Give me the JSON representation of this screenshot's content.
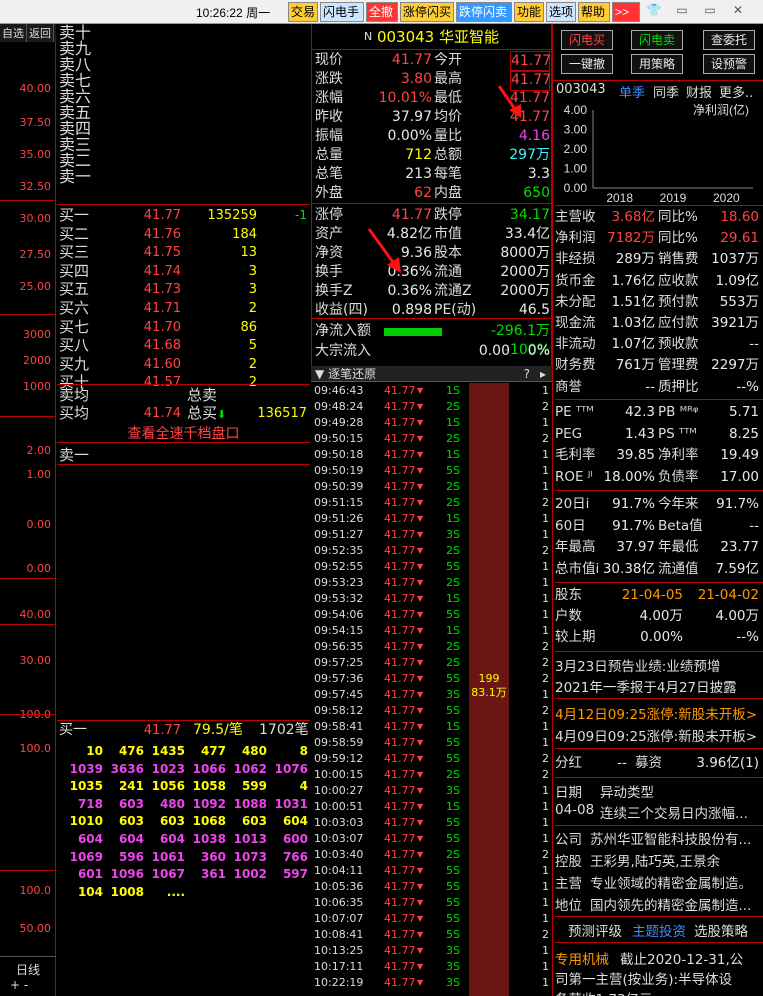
{
  "topbar": {
    "clock": "10:26:22",
    "weekday": "周一",
    "buttons": [
      {
        "label": "交易",
        "bg": "#ffcc33",
        "fg": "#000"
      },
      {
        "label": "闪电手",
        "bg": "#cce6ff",
        "fg": "#000"
      },
      {
        "label": "全撤",
        "bg": "#ff3333",
        "fg": "#fff"
      },
      {
        "label": "涨停闪买",
        "bg": "#ffcc33",
        "fg": "#000"
      },
      {
        "label": "跌停闪卖",
        "bg": "#3399ff",
        "fg": "#fff"
      },
      {
        "label": "功能",
        "bg": "#ffcc33",
        "fg": "#000"
      },
      {
        "label": "选项",
        "bg": "#cce6ff",
        "fg": "#000"
      },
      {
        "label": "帮助",
        "bg": "#ffcc33",
        "fg": "#000"
      },
      {
        "label": ">>",
        "bg": "#ff3333",
        "fg": "#fff"
      }
    ]
  },
  "left_tabs": [
    "自选",
    "返回"
  ],
  "left_axis_labels": [
    "40.00",
    "37.50",
    "35.00",
    "32.50",
    "30.00",
    "27.50",
    "25.00",
    "3000",
    "2000",
    "1000",
    "2.00",
    "1.00",
    "0.00",
    "0.00",
    "40.00",
    "30.00",
    "100.0",
    "100.0",
    "100.0",
    "50.00"
  ],
  "left_bottom": {
    "label": "日线",
    "plus": "+",
    "minus": "-"
  },
  "book": {
    "sell": [
      {
        "name": "卖十",
        "price": "",
        "vol": ""
      },
      {
        "name": "卖九",
        "price": "",
        "vol": ""
      },
      {
        "name": "卖八",
        "price": "",
        "vol": ""
      },
      {
        "name": "卖七",
        "price": "",
        "vol": ""
      },
      {
        "name": "卖六",
        "price": "",
        "vol": ""
      },
      {
        "name": "卖五",
        "price": "",
        "vol": ""
      },
      {
        "name": "卖四",
        "price": "",
        "vol": ""
      },
      {
        "name": "卖三",
        "price": "",
        "vol": ""
      },
      {
        "name": "卖二",
        "price": "",
        "vol": ""
      },
      {
        "name": "卖一",
        "price": "",
        "vol": ""
      }
    ],
    "buy": [
      {
        "name": "买一",
        "price": "41.77",
        "vol": "135259",
        "chg": "-1"
      },
      {
        "name": "买二",
        "price": "41.76",
        "vol": "184",
        "chg": ""
      },
      {
        "name": "买三",
        "price": "41.75",
        "vol": "13",
        "chg": ""
      },
      {
        "name": "买四",
        "price": "41.74",
        "vol": "3",
        "chg": ""
      },
      {
        "name": "买五",
        "price": "41.73",
        "vol": "3",
        "chg": ""
      },
      {
        "name": "买六",
        "price": "41.71",
        "vol": "2",
        "chg": ""
      },
      {
        "name": "买七",
        "price": "41.70",
        "vol": "86",
        "chg": ""
      },
      {
        "name": "买八",
        "price": "41.68",
        "vol": "5",
        "chg": ""
      },
      {
        "name": "买九",
        "price": "41.60",
        "vol": "2",
        "chg": ""
      },
      {
        "name": "买十",
        "price": "41.57",
        "vol": "2",
        "chg": ""
      }
    ],
    "sell_avg_label": "卖均",
    "total_sell_label": "总卖",
    "buy_avg_label": "买均",
    "buy_avg": "41.74",
    "total_buy_label": "总买",
    "total_buy": "136517",
    "full_book": "查看全速千档盘口",
    "sell1_label": "卖一",
    "queue_head": {
      "name": "买一",
      "price": "41.77",
      "per": "79.5/笔",
      "count": "1702笔"
    },
    "queue_rows": [
      [
        "10",
        "476",
        "1435",
        "477",
        "480",
        "8"
      ],
      [
        "1039",
        "3636",
        "1023",
        "1066",
        "1062",
        "1076"
      ],
      [
        "1035",
        "241",
        "1056",
        "1058",
        "599",
        "4"
      ],
      [
        "718",
        "603",
        "480",
        "1092",
        "1088",
        "1031"
      ],
      [
        "1010",
        "603",
        "603",
        "1068",
        "603",
        "604"
      ],
      [
        "604",
        "604",
        "604",
        "1038",
        "1013",
        "600"
      ],
      [
        "1069",
        "596",
        "1061",
        "360",
        "1073",
        "766"
      ],
      [
        "601",
        "1096",
        "1067",
        "361",
        "1002",
        "597"
      ],
      [
        "104",
        "1008",
        "....",
        "",
        "",
        ""
      ]
    ]
  },
  "quote": {
    "flag": "N",
    "code": "003043",
    "name": "华亚智能",
    "rows": [
      {
        "k1": "现价",
        "v1": "41.77",
        "c1": "red",
        "k2": "今开",
        "v2": "41.77",
        "c2": "red",
        "box2": true
      },
      {
        "k1": "涨跌",
        "v1": "3.80",
        "c1": "red",
        "k2": "最高",
        "v2": "41.77",
        "c2": "red",
        "box2": true
      },
      {
        "k1": "涨幅",
        "v1": "10.01%",
        "c1": "red",
        "k2": "最低",
        "v2": "41.77",
        "c2": "red"
      },
      {
        "k1": "昨收",
        "v1": "37.97",
        "c1": "wht",
        "k2": "均价",
        "v2": "41.77",
        "c2": "red"
      },
      {
        "k1": "振幅",
        "v1": "0.00%",
        "c1": "wht",
        "k2": "量比",
        "v2": "4.16",
        "c2": "mag"
      },
      {
        "k1": "总量",
        "v1": "712",
        "c1": "yel",
        "k2": "总额",
        "v2": "297万",
        "c2": "cyn"
      },
      {
        "k1": "总笔",
        "v1": "213",
        "c1": "wht",
        "k2": "每笔",
        "v2": "3.3",
        "c2": "wht"
      },
      {
        "k1": "外盘",
        "v1": "62",
        "c1": "red",
        "k2": "内盘",
        "v2": "650",
        "c2": "grn"
      },
      {
        "k1": "涨停",
        "v1": "41.77",
        "c1": "red",
        "k2": "跌停",
        "v2": "34.17",
        "c2": "grn"
      },
      {
        "k1": "资产",
        "v1": "4.82亿",
        "c1": "wht",
        "k2": "市值",
        "v2": "33.4亿",
        "c2": "wht"
      },
      {
        "k1": "净资",
        "v1": "9.36",
        "c1": "wht",
        "k2": "股本",
        "v2": "8000万",
        "c2": "wht"
      },
      {
        "k1": "换手",
        "v1": "0.36%",
        "c1": "wht",
        "k2": "流通",
        "v2": "2000万",
        "c2": "wht"
      },
      {
        "k1": "换手Z",
        "v1": "0.36%",
        "c1": "wht",
        "k2": "流通Z",
        "v2": "2000万",
        "c2": "wht"
      },
      {
        "k1": "收益(四)",
        "v1": "0.898",
        "c1": "wht",
        "k2": "PE(动)",
        "v2": "46.5",
        "c2": "wht"
      }
    ],
    "net_inflow_label": "净流入额",
    "net_inflow": "-296.1万",
    "net_inflow_pct": "-100%",
    "block_label": "大宗流入",
    "block_value": "0.00",
    "block_pct": "0%"
  },
  "ticks": {
    "header": "逐笔还原",
    "rows": [
      {
        "t": "09:46:43",
        "p": "41.77",
        "v": "1S",
        "n": "1"
      },
      {
        "t": "09:48:24",
        "p": "41.77",
        "v": "2S",
        "n": "2"
      },
      {
        "t": "09:49:28",
        "p": "41.77",
        "v": "1S",
        "n": "1"
      },
      {
        "t": "09:50:15",
        "p": "41.77",
        "v": "2S",
        "n": "2"
      },
      {
        "t": "09:50:18",
        "p": "41.77",
        "v": "1S",
        "n": "1"
      },
      {
        "t": "09:50:19",
        "p": "41.77",
        "v": "5S",
        "n": "1"
      },
      {
        "t": "09:50:39",
        "p": "41.77",
        "v": "2S",
        "n": "1"
      },
      {
        "t": "09:51:15",
        "p": "41.77",
        "v": "2S",
        "n": "2"
      },
      {
        "t": "09:51:26",
        "p": "41.77",
        "v": "1S",
        "n": "1"
      },
      {
        "t": "09:51:27",
        "p": "41.77",
        "v": "3S",
        "n": "1"
      },
      {
        "t": "09:52:35",
        "p": "41.77",
        "v": "2S",
        "n": "2"
      },
      {
        "t": "09:52:55",
        "p": "41.77",
        "v": "5S",
        "n": "1"
      },
      {
        "t": "09:53:23",
        "p": "41.77",
        "v": "2S",
        "n": "1"
      },
      {
        "t": "09:53:32",
        "p": "41.77",
        "v": "1S",
        "n": "1"
      },
      {
        "t": "09:54:06",
        "p": "41.77",
        "v": "5S",
        "n": "1"
      },
      {
        "t": "09:54:15",
        "p": "41.77",
        "v": "1S",
        "n": "1"
      },
      {
        "t": "09:56:35",
        "p": "41.77",
        "v": "2S",
        "n": "2"
      },
      {
        "t": "09:57:25",
        "p": "41.77",
        "v": "2S",
        "n": "2"
      },
      {
        "t": "09:57:36",
        "p": "41.77",
        "v": "5S",
        "n": "2"
      },
      {
        "t": "09:57:45",
        "p": "41.77",
        "v": "3S",
        "n": "1"
      },
      {
        "t": "09:58:12",
        "p": "41.77",
        "v": "5S",
        "n": "2"
      },
      {
        "t": "09:58:41",
        "p": "41.77",
        "v": "1S",
        "n": "1"
      },
      {
        "t": "09:58:59",
        "p": "41.77",
        "v": "5S",
        "n": "1"
      },
      {
        "t": "09:59:12",
        "p": "41.77",
        "v": "5S",
        "n": "2"
      },
      {
        "t": "10:00:15",
        "p": "41.77",
        "v": "2S",
        "n": "2"
      },
      {
        "t": "10:00:27",
        "p": "41.77",
        "v": "3S",
        "n": "1"
      },
      {
        "t": "10:00:51",
        "p": "41.77",
        "v": "1S",
        "n": "1"
      },
      {
        "t": "10:03:03",
        "p": "41.77",
        "v": "5S",
        "n": "1"
      },
      {
        "t": "10:03:07",
        "p": "41.77",
        "v": "5S",
        "n": "1"
      },
      {
        "t": "10:03:40",
        "p": "41.77",
        "v": "2S",
        "n": "2"
      },
      {
        "t": "10:04:11",
        "p": "41.77",
        "v": "5S",
        "n": "1"
      },
      {
        "t": "10:05:36",
        "p": "41.77",
        "v": "5S",
        "n": "1"
      },
      {
        "t": "10:06:35",
        "p": "41.77",
        "v": "5S",
        "n": "1"
      },
      {
        "t": "10:07:07",
        "p": "41.77",
        "v": "5S",
        "n": "1"
      },
      {
        "t": "10:08:41",
        "p": "41.77",
        "v": "5S",
        "n": "2"
      },
      {
        "t": "10:13:25",
        "p": "41.77",
        "v": "3S",
        "n": "1"
      },
      {
        "t": "10:17:11",
        "p": "41.77",
        "v": "3S",
        "n": "1"
      },
      {
        "t": "10:22:19",
        "p": "41.77",
        "v": "3S",
        "n": "1"
      }
    ],
    "bar_label1": "199",
    "bar_label2": "83.1万"
  },
  "right": {
    "buttons": [
      "闪电买",
      "闪电卖",
      "查委托",
      "一键撤",
      "用策略",
      "设预警"
    ],
    "code": "003043",
    "season": "单季",
    "yoy": "同季",
    "fin": "财报",
    "more": "更多..",
    "chart_title": "净利润(亿)",
    "chart_data": {
      "type": "bar",
      "categories": [
        "2018",
        "2019",
        "2020"
      ],
      "values": [
        0,
        0,
        0
      ],
      "ylim": [
        0,
        4
      ],
      "yticks": [
        "4.00",
        "3.00",
        "2.00",
        "1.00",
        "0.00"
      ]
    },
    "fin_rows": [
      {
        "a": "主营收",
        "b": "3.68亿",
        "c": "同比%",
        "d": "18.60",
        "bc": "red",
        "dc": "red"
      },
      {
        "a": "净利润",
        "b": "7182万",
        "c": "同比%",
        "d": "29.61",
        "bc": "red",
        "dc": "red"
      },
      {
        "a": "非经损",
        "b": "289万",
        "c": "销售费",
        "d": "1037万",
        "bc": "wht",
        "dc": "wht"
      },
      {
        "a": "货币金",
        "b": "1.76亿",
        "c": "应收款",
        "d": "1.09亿",
        "bc": "wht",
        "dc": "wht"
      },
      {
        "a": "未分配",
        "b": "1.51亿",
        "c": "预付款",
        "d": "553万",
        "bc": "wht",
        "dc": "wht"
      },
      {
        "a": "现金流",
        "b": "1.03亿",
        "c": "应付款",
        "d": "3921万",
        "bc": "wht",
        "dc": "wht"
      },
      {
        "a": "非流动",
        "b": "1.07亿",
        "c": "预收款",
        "d": "--",
        "bc": "wht",
        "dc": "wht"
      },
      {
        "a": "财务费",
        "b": "761万",
        "c": "管理费",
        "d": "2297万",
        "bc": "wht",
        "dc": "wht"
      },
      {
        "a": "商誉",
        "b": "--",
        "c": "质押比",
        "d": "--%",
        "bc": "wht",
        "dc": "wht"
      }
    ],
    "val_rows": [
      {
        "a": "PE ᵀᵀᴹ",
        "b": "42.3",
        "c": "PB ᴹᴿᵠ",
        "d": "5.71"
      },
      {
        "a": "PEG",
        "b": "1.43",
        "c": "PS ᵀᵀᴹ",
        "d": "8.25"
      },
      {
        "a": "毛利率",
        "b": "39.85",
        "c": "净利率",
        "d": "19.49"
      },
      {
        "a": "ROE ᴶᴵ",
        "b": "18.00%",
        "c": "负债率",
        "d": "17.00"
      }
    ],
    "perf_rows": [
      {
        "a": "20日i",
        "b": "91.7%",
        "c": "今年来",
        "d": "91.7%"
      },
      {
        "a": "60日",
        "b": "91.7%",
        "c": "Beta值",
        "d": "--"
      },
      {
        "a": "年最高",
        "b": "37.97",
        "c": "年最低",
        "d": "23.77"
      },
      {
        "a": "总市值i",
        "b": "30.38亿",
        "c": "流通值",
        "d": "7.59亿"
      }
    ],
    "holders": {
      "label": "股东",
      "d1": "21-04-05",
      "d2": "21-04-02",
      "hu": "户数",
      "h1": "4.00万",
      "h2": "4.00万",
      "cmp": "较上期",
      "c1": "0.00%",
      "c2": "--%"
    },
    "news": [
      "3月23日预告业绩:业绩预增",
      "2021年一季报于4月27日披露"
    ],
    "limit_news": [
      "4月12日09:25涨停:新股未开板>",
      "4月09日09:25涨停:新股未开板>"
    ],
    "dividend": {
      "a": "分红",
      "b": "--",
      "c": "募资",
      "d": "3.96亿(1)"
    },
    "abnormal": {
      "date_label": "日期",
      "type_label": "异动类型",
      "date": "04-08",
      "type": "连续三个交易日内涨幅..."
    },
    "company": [
      {
        "k": "公司",
        "v": "苏州华亚智能科技股份有..."
      },
      {
        "k": "控股",
        "v": "王彩男,陆巧英,王景余"
      },
      {
        "k": "主营",
        "v": "专业领域的精密金属制造。"
      },
      {
        "k": "地位",
        "v": "国内领先的精密金属制造..."
      }
    ],
    "bottom_tabs": [
      "预测评级",
      "主题投资",
      "选股策略"
    ],
    "footer_line1_tag": "专用机械",
    "footer_line1": "截止2020-12-31,公",
    "footer_line2": "司第一主营(按业务):半导体设",
    "footer_line3": "备营收1.73亿元..."
  },
  "colors": {
    "bg": "#000000",
    "grid": "#bb0000",
    "up": "#ff4444",
    "down": "#00dd00",
    "vol": "#ffff00"
  }
}
